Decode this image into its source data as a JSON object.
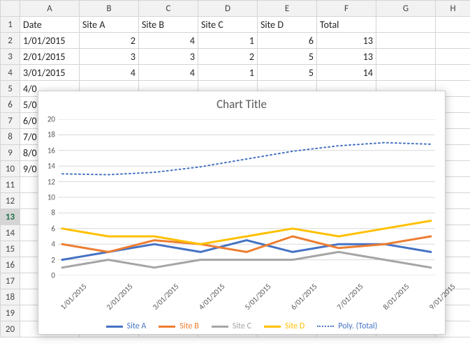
{
  "grid": {
    "colHeaders": [
      "A",
      "B",
      "C",
      "D",
      "E",
      "F",
      "G",
      "H"
    ],
    "rowCount": 20,
    "selectedRow": 13,
    "headerRow": {
      "A": "Date",
      "B": "Site A",
      "C": "Site B",
      "D": "Site C",
      "E": "Site D",
      "F": "Total"
    },
    "dataRows": [
      {
        "date": "1/01/2015",
        "a": 2,
        "b": 4,
        "c": 1,
        "d": 6,
        "total": 13
      },
      {
        "date": "2/01/2015",
        "a": 3,
        "b": 3,
        "c": 2,
        "d": 5,
        "total": 13
      },
      {
        "date": "3/01/2015",
        "a": 4,
        "b": 4,
        "c": 1,
        "d": 5,
        "total": 14
      }
    ],
    "partialDates": [
      "4/0",
      "5/0",
      "6/0",
      "7/0",
      "8/0",
      "9/0"
    ],
    "partialDatesFull": [
      "4/01/2015",
      "5/01/2015",
      "6/01/2015",
      "7/01/2015",
      "8/01/2015",
      "9/01/2015"
    ]
  },
  "chart_data": {
    "type": "line",
    "title": "Chart Title",
    "xlabel": "",
    "ylabel": "",
    "categories": [
      "1/01/2015",
      "2/01/2015",
      "3/01/2015",
      "4/01/2015",
      "5/01/2015",
      "6/01/2015",
      "7/01/2015",
      "8/01/2015",
      "9/01/2015"
    ],
    "ylim": [
      0,
      20
    ],
    "y_ticks": [
      0,
      2,
      4,
      6,
      8,
      10,
      12,
      14,
      16,
      18,
      20
    ],
    "series": [
      {
        "name": "Site A",
        "color": "#4472C4",
        "values": [
          2,
          3,
          4,
          3,
          4.5,
          3,
          4,
          4,
          3
        ]
      },
      {
        "name": "Site B",
        "color": "#ED7D31",
        "values": [
          4,
          3,
          4.5,
          4,
          3,
          5,
          3.5,
          4,
          5
        ]
      },
      {
        "name": "Site C",
        "color": "#A5A5A5",
        "values": [
          1,
          2,
          1,
          2,
          2,
          2,
          3,
          2,
          1
        ]
      },
      {
        "name": "Site D",
        "color": "#FFC000",
        "values": [
          6,
          5,
          5,
          4,
          5,
          6,
          5,
          6,
          7
        ]
      }
    ],
    "trendline": {
      "name": "Poly. (Total)",
      "color": "#4472C4",
      "style": "dotted",
      "values_est": [
        13,
        12.9,
        13.2,
        13.9,
        14.9,
        15.9,
        16.6,
        17.0,
        16.8
      ]
    }
  },
  "legend_labels": {
    "siteA": "Site A",
    "siteB": "Site B",
    "siteC": "Site C",
    "siteD": "Site D",
    "poly": "Poly. (Total)"
  },
  "colors": {
    "gridline": "#d9d9d9",
    "headerBg": "#f2f2f2",
    "excelGreen": "#217346"
  }
}
